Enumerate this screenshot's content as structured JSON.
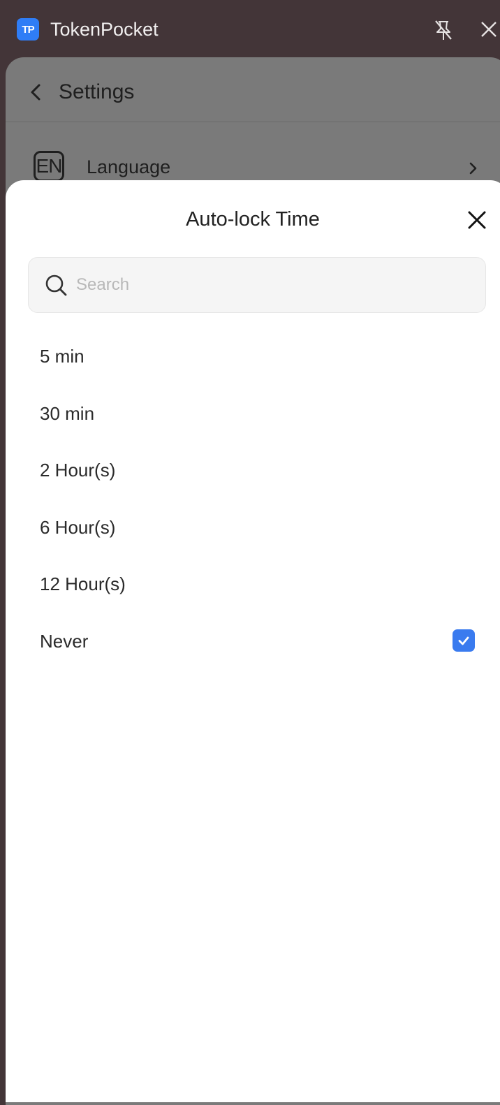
{
  "window": {
    "app_logo_text": "TP",
    "app_title": "TokenPocket"
  },
  "settings": {
    "title": "Settings",
    "language_icon_text": "EN",
    "language_label": "Language"
  },
  "sheet": {
    "title": "Auto-lock Time",
    "search_placeholder": "Search",
    "search_value": "",
    "options": [
      {
        "label": "5 min",
        "selected": false
      },
      {
        "label": "30 min",
        "selected": false
      },
      {
        "label": "2 Hour(s)",
        "selected": false
      },
      {
        "label": "6 Hour(s)",
        "selected": false
      },
      {
        "label": "12 Hour(s)",
        "selected": false
      },
      {
        "label": "Never",
        "selected": true
      }
    ]
  },
  "colors": {
    "titlebar_bg": "#433538",
    "overlay_panel": "#7a7a7a",
    "accent_blue": "#3a7bef",
    "logo_blue": "#2f7df6"
  },
  "icons": [
    "unpin-icon",
    "close-icon",
    "back-icon",
    "language-en-icon",
    "chevron-right-icon",
    "search-icon",
    "checkbox-checked-icon"
  ]
}
